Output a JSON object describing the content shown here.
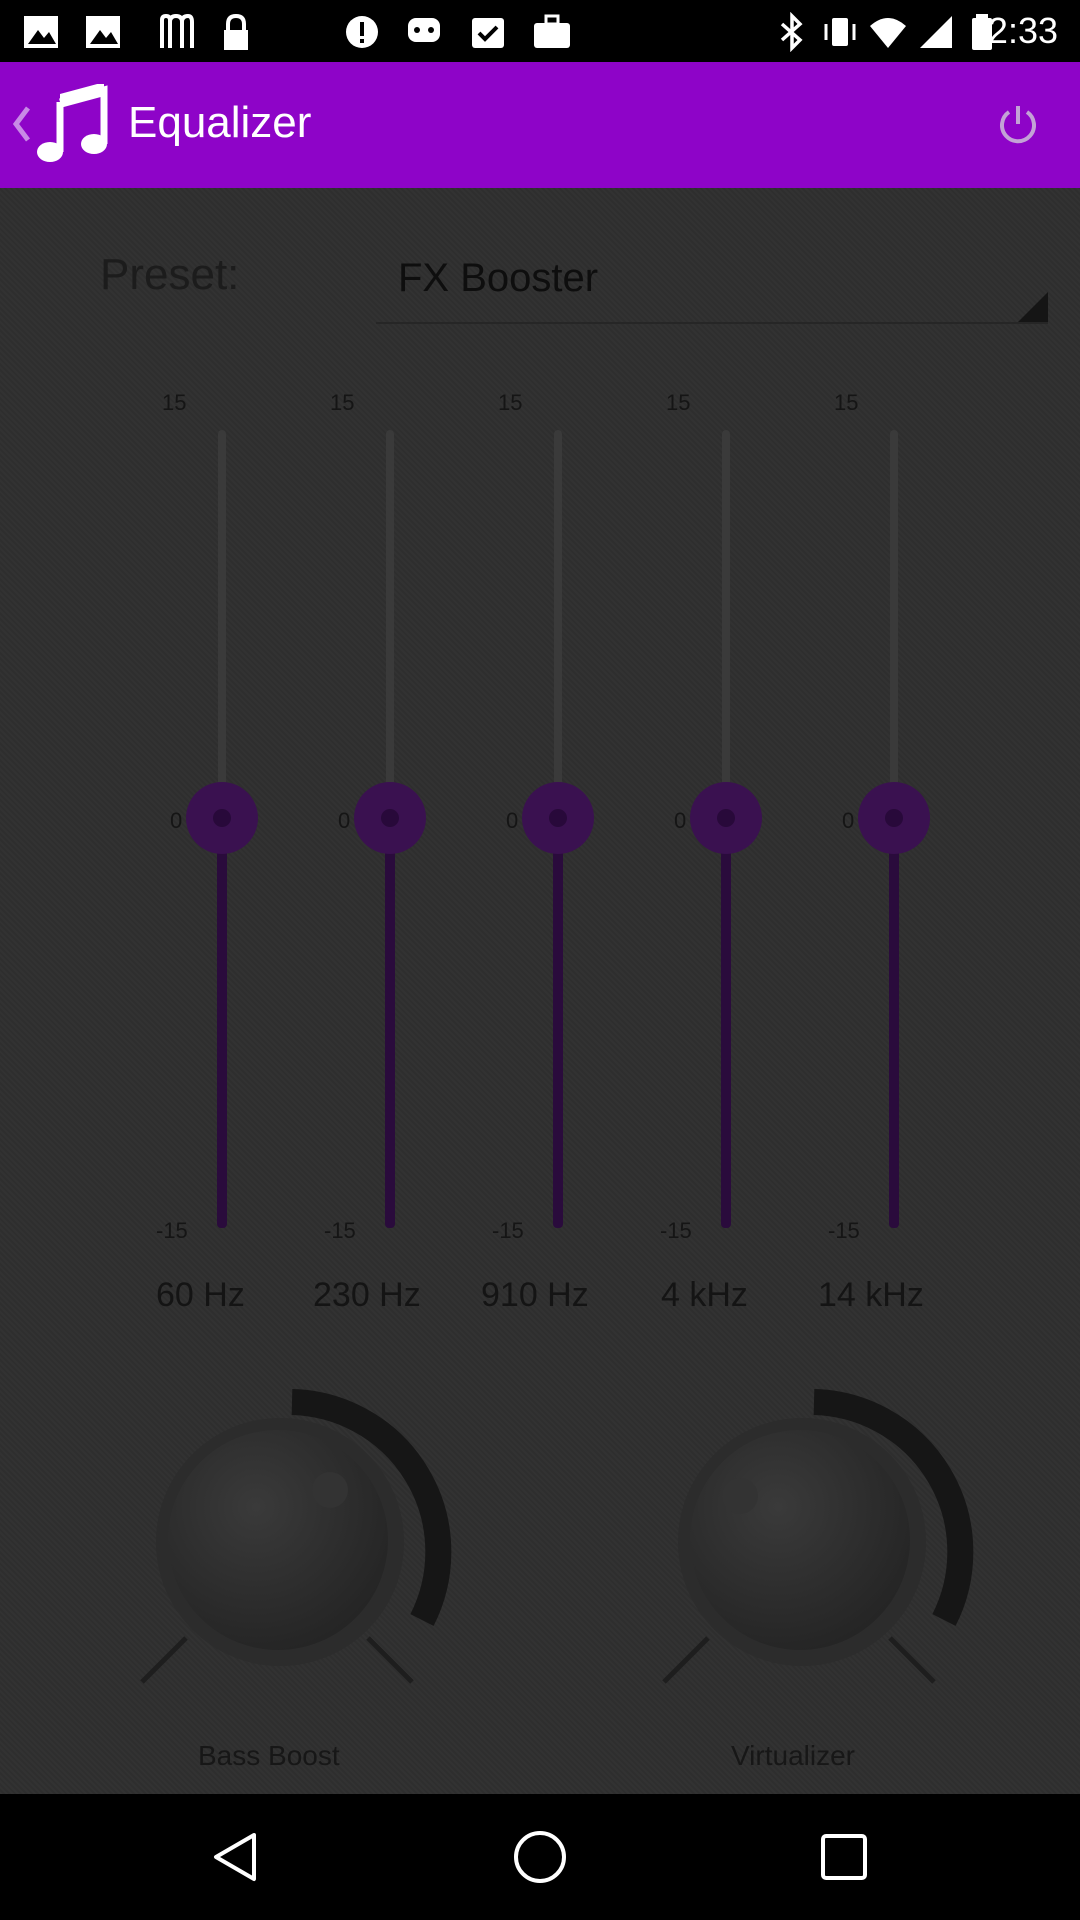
{
  "status_bar": {
    "time": "2:33",
    "icons": [
      "gallery-icon",
      "gallery-icon",
      "m-icon",
      "lock-icon",
      "info-icon",
      "game-controller-icon",
      "clipboard-check-icon",
      "briefcase-icon",
      "bluetooth-icon",
      "vibrate-icon",
      "wifi-icon",
      "signal-icon",
      "battery-icon"
    ]
  },
  "app_bar": {
    "title": "Equalizer",
    "icons": [
      "back-chevron-icon",
      "music-note-icon",
      "power-icon"
    ],
    "color": "#8e04c8"
  },
  "preset": {
    "label": "Preset:",
    "value": "FX Booster"
  },
  "bands": [
    {
      "frequency": "60 Hz",
      "max": "15",
      "zero": "0",
      "min": "-15",
      "level": 0
    },
    {
      "frequency": "230 Hz",
      "max": "15",
      "zero": "0",
      "min": "-15",
      "level": 0
    },
    {
      "frequency": "910 Hz",
      "max": "15",
      "zero": "0",
      "min": "-15",
      "level": 0
    },
    {
      "frequency": "4 kHz",
      "max": "15",
      "zero": "0",
      "min": "-15",
      "level": 0
    },
    {
      "frequency": "14 kHz",
      "max": "15",
      "zero": "0",
      "min": "-15",
      "level": 0
    }
  ],
  "knobs": [
    {
      "label": "Bass Boost"
    },
    {
      "label": "Virtualizer"
    }
  ],
  "nav_bar": {
    "icons": [
      "back-triangle-icon",
      "home-circle-icon",
      "recents-square-icon"
    ]
  }
}
